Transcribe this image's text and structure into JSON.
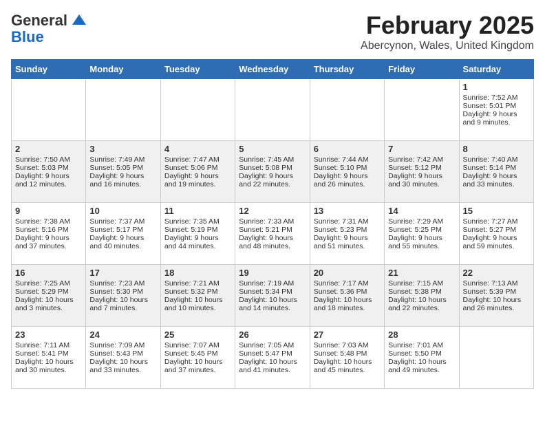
{
  "header": {
    "logo_line1": "General",
    "logo_line2": "Blue",
    "month": "February 2025",
    "location": "Abercynon, Wales, United Kingdom"
  },
  "days_of_week": [
    "Sunday",
    "Monday",
    "Tuesday",
    "Wednesday",
    "Thursday",
    "Friday",
    "Saturday"
  ],
  "weeks": [
    [
      {
        "num": "",
        "content": ""
      },
      {
        "num": "",
        "content": ""
      },
      {
        "num": "",
        "content": ""
      },
      {
        "num": "",
        "content": ""
      },
      {
        "num": "",
        "content": ""
      },
      {
        "num": "",
        "content": ""
      },
      {
        "num": "1",
        "content": "Sunrise: 7:52 AM\nSunset: 5:01 PM\nDaylight: 9 hours and 9 minutes."
      }
    ],
    [
      {
        "num": "2",
        "content": "Sunrise: 7:50 AM\nSunset: 5:03 PM\nDaylight: 9 hours and 12 minutes."
      },
      {
        "num": "3",
        "content": "Sunrise: 7:49 AM\nSunset: 5:05 PM\nDaylight: 9 hours and 16 minutes."
      },
      {
        "num": "4",
        "content": "Sunrise: 7:47 AM\nSunset: 5:06 PM\nDaylight: 9 hours and 19 minutes."
      },
      {
        "num": "5",
        "content": "Sunrise: 7:45 AM\nSunset: 5:08 PM\nDaylight: 9 hours and 22 minutes."
      },
      {
        "num": "6",
        "content": "Sunrise: 7:44 AM\nSunset: 5:10 PM\nDaylight: 9 hours and 26 minutes."
      },
      {
        "num": "7",
        "content": "Sunrise: 7:42 AM\nSunset: 5:12 PM\nDaylight: 9 hours and 30 minutes."
      },
      {
        "num": "8",
        "content": "Sunrise: 7:40 AM\nSunset: 5:14 PM\nDaylight: 9 hours and 33 minutes."
      }
    ],
    [
      {
        "num": "9",
        "content": "Sunrise: 7:38 AM\nSunset: 5:16 PM\nDaylight: 9 hours and 37 minutes."
      },
      {
        "num": "10",
        "content": "Sunrise: 7:37 AM\nSunset: 5:17 PM\nDaylight: 9 hours and 40 minutes."
      },
      {
        "num": "11",
        "content": "Sunrise: 7:35 AM\nSunset: 5:19 PM\nDaylight: 9 hours and 44 minutes."
      },
      {
        "num": "12",
        "content": "Sunrise: 7:33 AM\nSunset: 5:21 PM\nDaylight: 9 hours and 48 minutes."
      },
      {
        "num": "13",
        "content": "Sunrise: 7:31 AM\nSunset: 5:23 PM\nDaylight: 9 hours and 51 minutes."
      },
      {
        "num": "14",
        "content": "Sunrise: 7:29 AM\nSunset: 5:25 PM\nDaylight: 9 hours and 55 minutes."
      },
      {
        "num": "15",
        "content": "Sunrise: 7:27 AM\nSunset: 5:27 PM\nDaylight: 9 hours and 59 minutes."
      }
    ],
    [
      {
        "num": "16",
        "content": "Sunrise: 7:25 AM\nSunset: 5:29 PM\nDaylight: 10 hours and 3 minutes."
      },
      {
        "num": "17",
        "content": "Sunrise: 7:23 AM\nSunset: 5:30 PM\nDaylight: 10 hours and 7 minutes."
      },
      {
        "num": "18",
        "content": "Sunrise: 7:21 AM\nSunset: 5:32 PM\nDaylight: 10 hours and 10 minutes."
      },
      {
        "num": "19",
        "content": "Sunrise: 7:19 AM\nSunset: 5:34 PM\nDaylight: 10 hours and 14 minutes."
      },
      {
        "num": "20",
        "content": "Sunrise: 7:17 AM\nSunset: 5:36 PM\nDaylight: 10 hours and 18 minutes."
      },
      {
        "num": "21",
        "content": "Sunrise: 7:15 AM\nSunset: 5:38 PM\nDaylight: 10 hours and 22 minutes."
      },
      {
        "num": "22",
        "content": "Sunrise: 7:13 AM\nSunset: 5:39 PM\nDaylight: 10 hours and 26 minutes."
      }
    ],
    [
      {
        "num": "23",
        "content": "Sunrise: 7:11 AM\nSunset: 5:41 PM\nDaylight: 10 hours and 30 minutes."
      },
      {
        "num": "24",
        "content": "Sunrise: 7:09 AM\nSunset: 5:43 PM\nDaylight: 10 hours and 33 minutes."
      },
      {
        "num": "25",
        "content": "Sunrise: 7:07 AM\nSunset: 5:45 PM\nDaylight: 10 hours and 37 minutes."
      },
      {
        "num": "26",
        "content": "Sunrise: 7:05 AM\nSunset: 5:47 PM\nDaylight: 10 hours and 41 minutes."
      },
      {
        "num": "27",
        "content": "Sunrise: 7:03 AM\nSunset: 5:48 PM\nDaylight: 10 hours and 45 minutes."
      },
      {
        "num": "28",
        "content": "Sunrise: 7:01 AM\nSunset: 5:50 PM\nDaylight: 10 hours and 49 minutes."
      },
      {
        "num": "",
        "content": ""
      }
    ]
  ]
}
